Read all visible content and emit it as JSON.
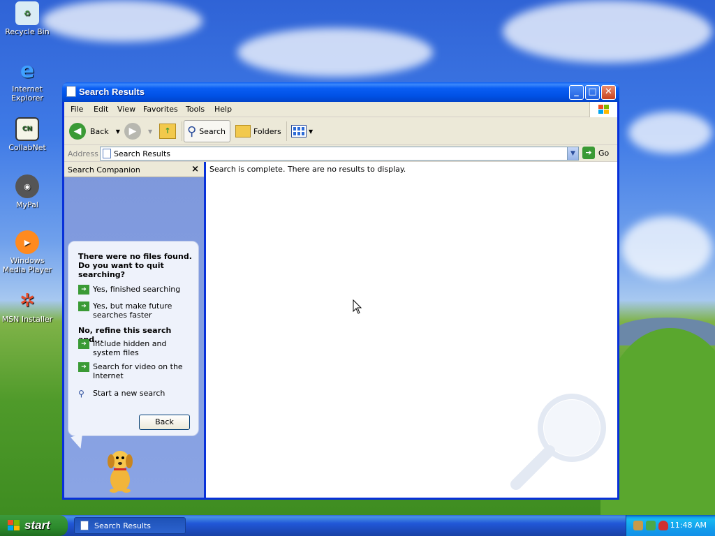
{
  "desktop": {
    "icons": [
      {
        "label": "Recycle Bin",
        "icon": "recycle-bin-icon"
      },
      {
        "label": "Internet Explorer",
        "icon": "internet-explorer-icon"
      },
      {
        "label": "CollabNet",
        "icon": "collabnet-icon"
      },
      {
        "label": "MyPal",
        "icon": "mypal-icon"
      },
      {
        "label": "Windows Media Player",
        "icon": "media-player-icon"
      },
      {
        "label": "MSN Installer",
        "icon": "msn-icon"
      }
    ]
  },
  "window": {
    "title": "Search Results",
    "menu": [
      "File",
      "Edit",
      "View",
      "Favorites",
      "Tools",
      "Help"
    ],
    "toolbar": {
      "back_label": "Back",
      "search_label": "Search",
      "folders_label": "Folders"
    },
    "address": {
      "label": "Address",
      "value": "Search Results",
      "go_label": "Go"
    },
    "companion": {
      "header": "Search Companion",
      "question": "There were no files found. Do you want to quit searching?",
      "option_finished": "Yes, finished searching",
      "option_faster": "Yes, but make future searches faster",
      "refine_title": "No, refine this search and...",
      "option_hidden": "Include hidden and system files",
      "option_video": "Search for video on the Internet",
      "option_new": "Start a new search",
      "back_button": "Back"
    },
    "results": {
      "status": "Search is complete. There are no results to display."
    }
  },
  "taskbar": {
    "start_label": "start",
    "task_label": "Search Results",
    "clock": "11:48 AM"
  },
  "colors": {
    "title_blue": "#0a5ef4",
    "companion_blue": "#7e98dc",
    "start_green": "#2c8a2c",
    "go_green": "#3a9a35"
  }
}
